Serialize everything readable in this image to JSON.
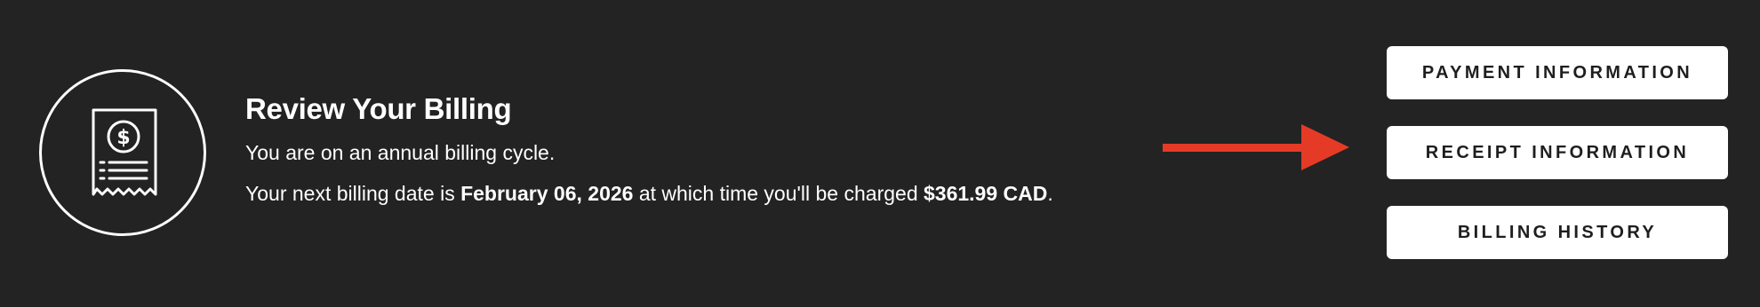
{
  "billing": {
    "title": "Review Your Billing",
    "cycle_text": "You are on an annual billing cycle.",
    "next_prefix": "Your next billing date is ",
    "next_date": "February 06, 2026",
    "next_middle": " at which time you'll be charged ",
    "next_amount": "$361.99 CAD",
    "next_suffix": "."
  },
  "buttons": {
    "payment_label": "PAYMENT INFORMATION",
    "receipt_label": "RECEIPT INFORMATION",
    "history_label": "BILLING HISTORY"
  },
  "icons": {
    "receipt": "receipt-dollar-icon",
    "arrow": "arrow-right-icon"
  },
  "colors": {
    "background": "#232323",
    "text": "#ffffff",
    "button_bg": "#ffffff",
    "button_text": "#1e1e1e",
    "arrow": "#e53b26"
  }
}
